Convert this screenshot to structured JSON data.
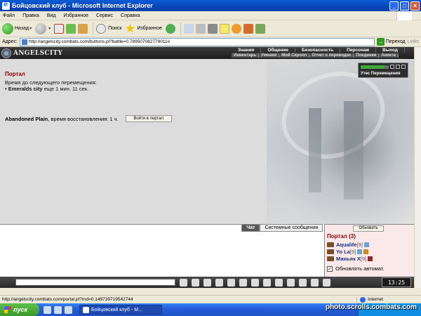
{
  "window": {
    "title": "Бойцовский клуб - Microsoft Internet Explorer",
    "minimize": "_",
    "maximize": "□",
    "close": "✕"
  },
  "menu": [
    "Файл",
    "Правка",
    "Вид",
    "Избранное",
    "Сервис",
    "Справка"
  ],
  "toolbar": {
    "back_label": "Назад",
    "search_label": "Поиск",
    "favorites_label": "Избранное"
  },
  "address": {
    "label": "Адрес:",
    "url": "http://angelscity.combats.com/buttons.pl?battle=0.789507082779011#",
    "go_label": "Переход",
    "links_label": "Links"
  },
  "game": {
    "logo": "ANGELSCITY",
    "nav_top": [
      "Знания",
      "Общение",
      "Безопасность",
      "Персонаж",
      "Выход"
    ],
    "nav_bottom": [
      "Инвентарь",
      "Умения",
      "Мой Скролл",
      "Отчет о переводах",
      "Поединки",
      "Анкета"
    ],
    "status_label": "Утес Перемещения",
    "health_fraction": 0.85
  },
  "portal": {
    "heading": "Портал",
    "next_move_label": "Время до следующего перемещения:",
    "destination": "Emeralds city",
    "destination_time": "еще 1 мин. 11 сек.",
    "plain_name": "Abandoned Plain",
    "plain_restore": ", время восстановления: 1 ч.",
    "enter_button": "Войти в портал"
  },
  "chat": {
    "tabs": [
      "Чат",
      "Системные сообщения"
    ]
  },
  "online": {
    "refresh_button": "Обновить",
    "title": "Портал (3)",
    "users": [
      {
        "name": "Aqualife",
        "level": "[9]"
      },
      {
        "name": "Yo La",
        "level": "[9]"
      },
      {
        "name": "Маньяк Х",
        "level": "[9]"
      }
    ],
    "auto_refresh_label": "Обновлять автомат.",
    "auto_refresh_checked": "✓"
  },
  "gamebar": {
    "clock": "13:25"
  },
  "statusbar": {
    "url": "http://angelscity.combats.com/portal.pl?rnd=0.149739719542744",
    "zone": "Internet"
  },
  "taskbar": {
    "start_label": "пуск",
    "task_label": "Бойцовский клуб - М...",
    "watermark": "photo.scrolls.combats.com"
  },
  "colors": {
    "accent_dark_red": "#8b0000",
    "user_blue": "#1a2f7a",
    "titlebar_blue": "#0a5bd6"
  }
}
